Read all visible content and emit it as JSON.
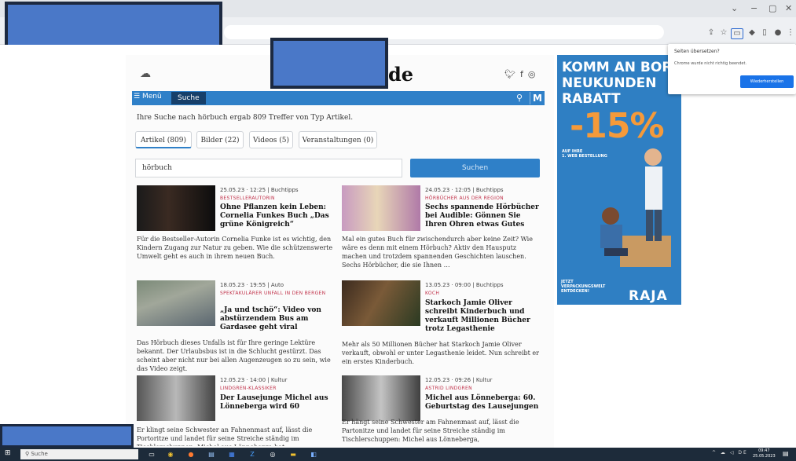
{
  "browser": {
    "window_controls": [
      "⌄",
      "−",
      "▢",
      "✕"
    ],
    "toolbar_icons": [
      "share-icon",
      "star-icon",
      "translate-icon",
      "extension-icon",
      "sidebar-icon",
      "profile-icon",
      "menu-icon"
    ]
  },
  "site": {
    "logo_suffix": "de",
    "social": [
      "twitter-icon",
      "facebook-icon",
      "instagram-icon"
    ],
    "nav": {
      "menu_label": "Menü",
      "search_tab": "Suche",
      "m_label": "M"
    },
    "summary": "Ihre Suche nach hörbuch ergab 809 Treffer von Typ Artikel.",
    "filter_tabs": [
      {
        "label": "Artikel (809)",
        "active": true
      },
      {
        "label": "Bilder (22)",
        "active": false
      },
      {
        "label": "Videos (5)",
        "active": false
      },
      {
        "label": "Veranstaltungen (0)",
        "active": false
      }
    ],
    "search": {
      "value": "hörbuch",
      "button": "Suchen"
    }
  },
  "articles": [
    {
      "meta": "25.05.23 · 12:25 | Buchtipps",
      "category": "BESTSELLERAUTORIN",
      "title": "Ohne Pflanzen kein Leben: Cornelia Funkes Buch „Das grüne Königreich“",
      "excerpt": "Für die Bestseller-Autorin Cornelia Funke ist es wichtig, den Kindern Zugang zur Natur zu geben. Wie die schützenswerte Umwelt geht es auch in ihrem neuen Buch."
    },
    {
      "meta": "24.05.23 · 12:05 | Buchtipps",
      "category": "HÖRBÜCHER AUS DER REGION",
      "title": "Sechs spannende Hörbücher bei Audible: Gönnen Sie Ihren Ohren etwas Gutes",
      "excerpt": "Mal ein gutes Buch für zwischendurch aber keine Zeit? Wie wäre es denn mit einem Hörbuch? Aktiv den Hausputz machen und trotzdem spannenden Geschichten lauschen. Sechs Hörbücher, die sie Ihnen …"
    },
    {
      "meta": "18.05.23 · 19:55 | Auto",
      "category": "SPEKTAKULÄRER UNFALL IN DEN BERGEN",
      "title": "„Ja und tschö“: Video von abstürzendem Bus am Gardasee geht viral",
      "excerpt": "Das Hörbuch dieses Unfalls ist für Ihre geringe Lektüre bekannt. Der Urlaubsbus ist in die Schlucht gestürzt. Das scheint aber nicht nur bei allen Augenzeugen so zu sein, wie das Video zeigt."
    },
    {
      "meta": "13.05.23 · 09:00 | Buchtipps",
      "category": "KOCH",
      "title": "Starkoch Jamie Oliver schreibt Kinderbuch und verkauft Millionen Bücher trotz Legasthenie",
      "excerpt": "Mehr als 50 Millionen Bücher hat Starkoch Jamie Oliver verkauft, obwohl er unter Legasthenie leidet. Nun schreibt er ein erstes Kinderbuch."
    },
    {
      "meta": "12.05.23 · 14:00 | Kultur",
      "category": "LINDGREN-KLASSIKER",
      "title": "Der Lausejunge Michel aus Lönneberga wird 60",
      "excerpt": "Er klingt seine Schwester an Fahnenmast auf, lässt die Portoritze und landet für seine Streiche ständig im Tischlerschuppen: Michel aus Lönneberga hat"
    },
    {
      "meta": "12.05.23 · 09:26 | Kultur",
      "category": "ASTRID LINDGREN",
      "title": "Michel aus Lönneberga: 60. Geburtstag des Lausejungen",
      "excerpt": "Er hängt seine Schwester am Fahnenmast auf, lässt die Partonitze und landet für seine Streiche ständig im Tischlerschuppen: Michel aus Lönneberga,"
    }
  ],
  "ad": {
    "headline": "KOMM AN BOR\nNEUKUNDEN\nRABATT",
    "discount": "-15%",
    "subtext": "AUF IHRE\n1. WEB BESTELLUNG",
    "footer": "JETZT\nVERPACKUNGSWELT\nENTDECKEN!",
    "brand": "RAJA",
    "color": "#2f7fc3",
    "accent": "#f59a3a"
  },
  "popup": {
    "title": "Seiten übersetzen?",
    "text": "Chrome wurde nicht richtig beendet.",
    "button": "Wiederherstellen"
  },
  "taskbar": {
    "search_placeholder": "Suche",
    "tray": "^ ☁ ◁ DE",
    "clock": "09:47\n25.05.2023",
    "apps": [
      "taskview-icon",
      "chrome-icon",
      "firefox-icon",
      "store-icon",
      "word-icon",
      "zoom-icon",
      "settings-icon",
      "explorer-icon",
      "app-icon"
    ]
  },
  "accent": "#2f80c8"
}
